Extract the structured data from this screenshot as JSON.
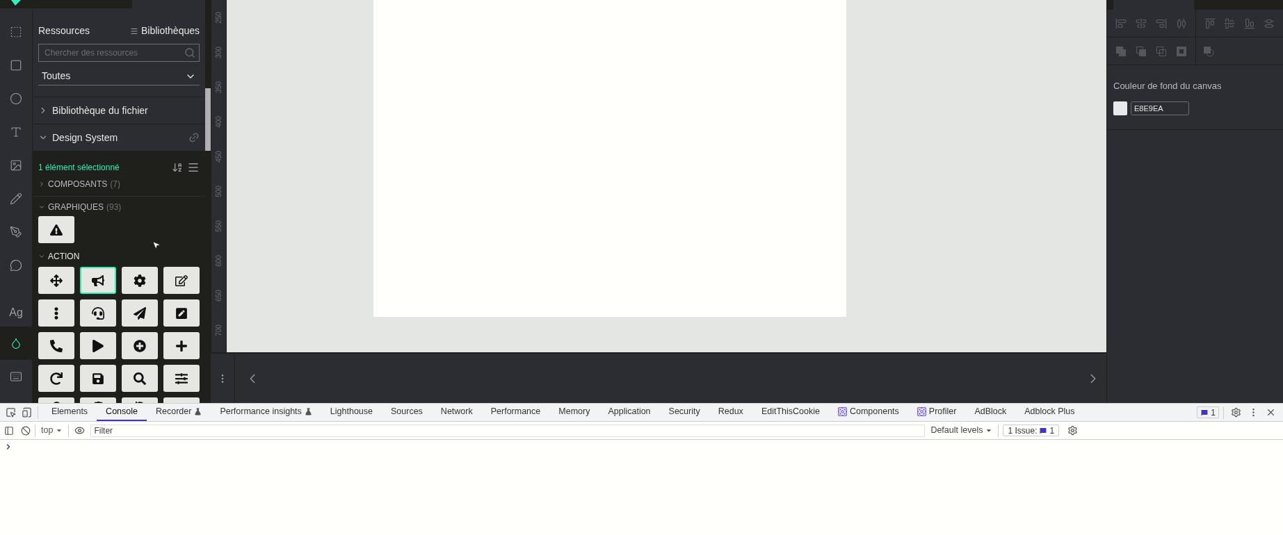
{
  "left_toolbar": {
    "tools": [
      {
        "kind": "logo",
        "selected": false
      },
      {
        "kind": "frame",
        "selected": false
      },
      {
        "kind": "rectangle",
        "selected": false
      },
      {
        "kind": "ellipse",
        "selected": false
      },
      {
        "kind": "text",
        "selected": false
      },
      {
        "kind": "image",
        "selected": false
      },
      {
        "kind": "pencil",
        "selected": false
      },
      {
        "kind": "pen",
        "selected": false
      },
      {
        "kind": "comment",
        "selected": false
      },
      {
        "kind": "typography",
        "label": "Ag",
        "selected": false
      },
      {
        "kind": "color",
        "selected": true
      },
      {
        "kind": "keyboard",
        "selected": false
      }
    ]
  },
  "resources_panel": {
    "title": "Ressources",
    "libraries_button": "Bibliothèques",
    "search": {
      "placeholder": "Chercher des ressources"
    },
    "filter": {
      "value": "Toutes"
    },
    "sections": [
      {
        "title": "Bibliothèque du fichier",
        "expanded": false,
        "linked": false
      },
      {
        "title": "Design System",
        "expanded": true,
        "linked": true
      }
    ],
    "selection_status": "1 élément sélectionné",
    "groups": [
      {
        "title": "COMPOSANTS",
        "count": "(7)",
        "expanded": false
      },
      {
        "title": "GRAPHIQUES",
        "count": "(93)",
        "expanded": true
      }
    ],
    "graphics": [
      {
        "selected": false
      }
    ],
    "action_group": {
      "title": "ACTION",
      "expanded": true
    },
    "action_icons": [
      {
        "selected": false
      },
      {
        "selected": true
      },
      {
        "selected": false
      },
      {
        "selected": false
      },
      {
        "selected": false
      },
      {
        "selected": false
      },
      {
        "selected": false
      },
      {
        "selected": false
      },
      {
        "selected": false
      },
      {
        "selected": false
      },
      {
        "selected": false
      },
      {
        "selected": false
      },
      {
        "selected": false
      },
      {
        "selected": false
      },
      {
        "selected": false
      },
      {
        "selected": false
      },
      {
        "selected": false
      },
      {
        "selected": false
      },
      {
        "selected": false
      },
      {
        "selected": false
      }
    ]
  },
  "canvas": {
    "ruler_labels": [
      "250",
      "300",
      "350",
      "400",
      "450",
      "500",
      "550",
      "600",
      "650",
      "700"
    ]
  },
  "design_panel": {
    "canvas_background": {
      "label": "Couleur de fond du canvas",
      "value": "E8E9EA"
    }
  },
  "devtools": {
    "tabs": [
      {
        "label": "Elements",
        "kind": "plain",
        "selected": false
      },
      {
        "label": "Console",
        "kind": "plain",
        "selected": true
      },
      {
        "label": "Recorder",
        "kind": "flask",
        "selected": false
      },
      {
        "label": "Performance insights",
        "kind": "flask",
        "selected": false
      },
      {
        "label": "Lighthouse",
        "kind": "plain",
        "selected": false
      },
      {
        "label": "Sources",
        "kind": "plain",
        "selected": false
      },
      {
        "label": "Network",
        "kind": "plain",
        "selected": false
      },
      {
        "label": "Performance",
        "kind": "plain",
        "selected": false
      },
      {
        "label": "Memory",
        "kind": "plain",
        "selected": false
      },
      {
        "label": "Application",
        "kind": "plain",
        "selected": false
      },
      {
        "label": "Security",
        "kind": "plain",
        "selected": false
      },
      {
        "label": "Redux",
        "kind": "plain",
        "selected": false
      },
      {
        "label": "EditThisCookie",
        "kind": "plain",
        "selected": false
      },
      {
        "label": "Components",
        "kind": "react",
        "selected": false
      },
      {
        "label": "Profiler",
        "kind": "react",
        "selected": false
      },
      {
        "label": "AdBlock",
        "kind": "plain",
        "selected": false
      },
      {
        "label": "Adblock Plus",
        "kind": "plain",
        "selected": false
      }
    ],
    "issues_badge": "1",
    "console_toolbar": {
      "context": "top",
      "filter_placeholder": "Filter",
      "levels": "Default levels",
      "issues": {
        "label": "1 Issue:",
        "count": "1"
      }
    }
  }
}
